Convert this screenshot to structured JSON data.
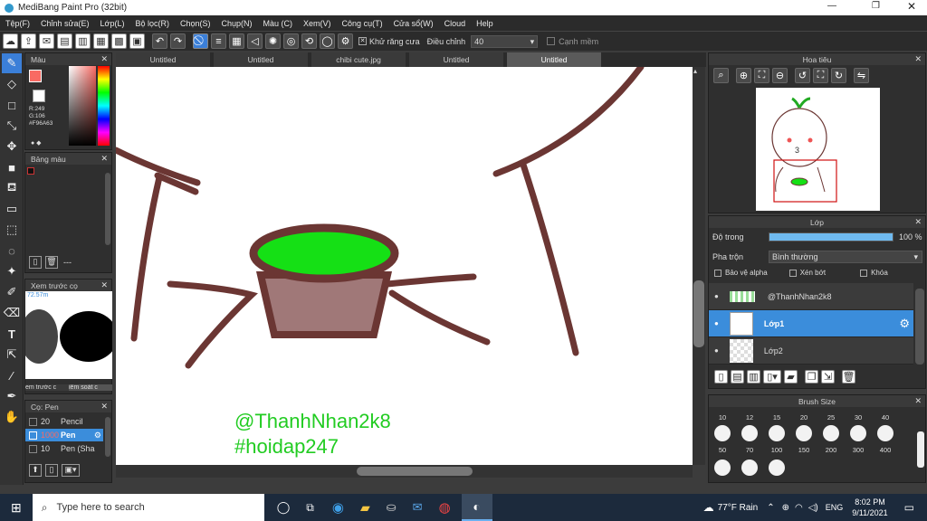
{
  "app": {
    "title": "MediBang Paint Pro (32bit)",
    "accent": "#3b8ddb"
  },
  "menu": [
    "Tệp(F)",
    "Chỉnh sửa(E)",
    "Lớp(L)",
    "Bộ lọc(R)",
    "Chọn(S)",
    "Chụp(N)",
    "Màu (C)",
    "Xem(V)",
    "Công cụ(T)",
    "Cửa sổ(W)",
    "Cloud",
    "Help"
  ],
  "toolbar": {
    "antialias_label": "Khử răng cưa",
    "adjust_label": "Điều chỉnh",
    "adjust_value": "40",
    "snap_label": "Cạnh mềm"
  },
  "tabs": [
    "Untitled",
    "Untitled",
    "chibi cute.jpg",
    "Untitled",
    "Untitled"
  ],
  "color_panel": {
    "title": "Màu",
    "r": "R:249",
    "g": "G:106",
    "hex": "#F96A63",
    "color": "#F96A63"
  },
  "palette_panel": {
    "title": "Bảng màu",
    "dash": "---"
  },
  "preview_panel": {
    "title": "Xem trước cọ",
    "zoom": "72.57m",
    "tab1": "em trước c",
    "tab2": "iểm soát c"
  },
  "brush_panel": {
    "title": "Cọ: Pen",
    "items": [
      {
        "size": "20",
        "name": "Pencil"
      },
      {
        "size": "1000",
        "name": "Pen"
      },
      {
        "size": "10",
        "name": "Pen (Sha"
      }
    ]
  },
  "navigator": {
    "title": "Hoa tiêu"
  },
  "layer_panel": {
    "title": "Lớp",
    "opacity_label": "Độ trong",
    "opacity_value": "100 %",
    "opacity": 1.0,
    "blend_label": "Pha trộn",
    "blend_value": "Bình thường",
    "protect_alpha": "Bảo vệ alpha",
    "clipping": "Xén bớt",
    "lock": "Khóa",
    "layers": [
      "@ThanhNhan2k8",
      "Lớp1",
      "Lớp2"
    ]
  },
  "brush_size_panel": {
    "title": "Brush Size",
    "row1": [
      "10",
      "12",
      "15",
      "20",
      "25",
      "30",
      "40"
    ],
    "row2": [
      "50",
      "70",
      "100",
      "150",
      "200",
      "300",
      "400"
    ]
  },
  "canvas_text": {
    "line1": "@ThanhNhan2k8",
    "line2": "#hoidap247",
    "color": "#22cc22"
  },
  "taskbar": {
    "search": "Type here to search",
    "weather": "77°F Rain",
    "lang": "ENG",
    "time": "8:02 PM",
    "date": "9/11/2021"
  }
}
